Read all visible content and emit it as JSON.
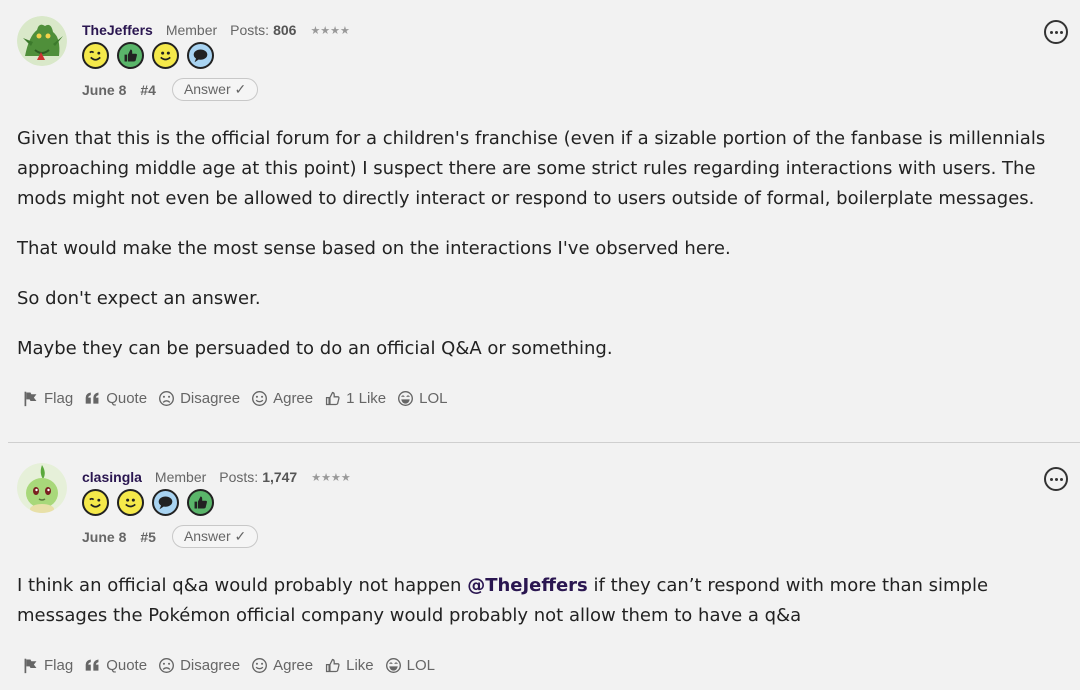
{
  "posts": [
    {
      "username": "TheJeffers",
      "role": "Member",
      "posts_label": "Posts:",
      "posts_count": "806",
      "rank": "★★★★",
      "badges": [
        "wink-badge",
        "thumbs-up-badge",
        "smile-badge",
        "speech-badge"
      ],
      "date": "June 8",
      "post_number": "#4",
      "answer_label": "Answer ✓",
      "paragraphs": [
        "Given that this is the official forum for a children's franchise (even if a sizable portion of the fanbase is millennials approaching middle age at this point) I suspect there are some strict rules regarding interactions with users. The mods might not even be allowed to directly interact or respond to users outside of formal, boilerplate messages.",
        "That would make the most sense based on the interactions I've observed here.",
        "So don't expect an answer.",
        "Maybe they can be persuaded to do an official Q&A or something."
      ],
      "actions": {
        "flag": "Flag",
        "quote": "Quote",
        "disagree": "Disagree",
        "agree": "Agree",
        "like": "1 Like",
        "lol": "LOL"
      }
    },
    {
      "username": "clasingla",
      "role": "Member",
      "posts_label": "Posts:",
      "posts_count": "1,747",
      "rank": "★★★★",
      "badges": [
        "wink-badge",
        "smile-badge",
        "speech-badge",
        "thumbs-up-badge"
      ],
      "date": "June 8",
      "post_number": "#5",
      "answer_label": "Answer ✓",
      "body_before": "I think an official q&a would probably not happen ",
      "mention": "@TheJeffers",
      "body_after": " if they can’t respond with more than simple messages the Pokémon official company would probably not allow them to have a q&a",
      "actions": {
        "flag": "Flag",
        "quote": "Quote",
        "disagree": "Disagree",
        "agree": "Agree",
        "like": "Like",
        "lol": "LOL"
      }
    }
  ],
  "colors": {
    "background": "#f2f2f2",
    "username": "#2a1650",
    "badge_yellow": "#f5e94a",
    "badge_green": "#5ab56a",
    "badge_blue": "#a9d4f2"
  }
}
